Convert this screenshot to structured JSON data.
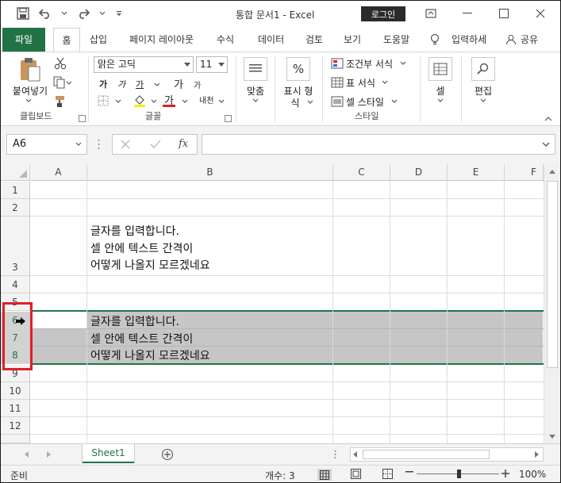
{
  "window": {
    "title": "통합 문서1  -  Excel",
    "login_label": "로그인"
  },
  "ribbon_tabs": [
    "파일",
    "홈",
    "삽입",
    "페이지 레이아웃",
    "수식",
    "데이터",
    "검토",
    "보기",
    "도움말",
    "입력하세",
    "공유"
  ],
  "ribbon": {
    "clipboard": {
      "paste_label": "붙여넣기",
      "group_label": "클립보드"
    },
    "font": {
      "font_name": "맑은 고딕",
      "font_size": "11",
      "bold": "가",
      "italic": "가",
      "underline": "가",
      "grow": "가",
      "shrink": "가",
      "font_color_glyph": "가",
      "phonetic": "내천",
      "group_label": "글꼴"
    },
    "alignment": {
      "label": "맞춤"
    },
    "number": {
      "glyph": "%",
      "label_line1": "표시 형",
      "label_line2": "식"
    },
    "styles": {
      "conditional": "조건부 서식",
      "table": "표 서식",
      "cell_style": "셀 스타일",
      "group_label": "스타일"
    },
    "cells": {
      "label": "셀"
    },
    "editing": {
      "label": "편집"
    }
  },
  "formula_bar": {
    "name_box": "A6",
    "fx": "fx",
    "formula": ""
  },
  "columns": [
    "A",
    "B",
    "C",
    "D",
    "E",
    "F"
  ],
  "rows": [
    "1",
    "2",
    "3",
    "4",
    "5",
    "6",
    "7",
    "8",
    "9",
    "10",
    "11",
    "12"
  ],
  "cells": {
    "B3_line1": "글자를 입력합니다.",
    "B3_line2": "셀 안에 텍스트 간격이",
    "B3_line3": "어떻게 나올지 모르겠네요",
    "B6": "글자를 입력합니다.",
    "B7": "셀 안에 텍스트 간격이",
    "B8": "어떻게 나올지 모르겠네요"
  },
  "sheets": {
    "active": "Sheet1"
  },
  "status": {
    "ready": "준비",
    "count": "개수: 3",
    "zoom": "100%"
  },
  "colors": {
    "excel_green": "#217346",
    "selection": "#c6c6c6",
    "highlight_red": "#e0202a"
  }
}
